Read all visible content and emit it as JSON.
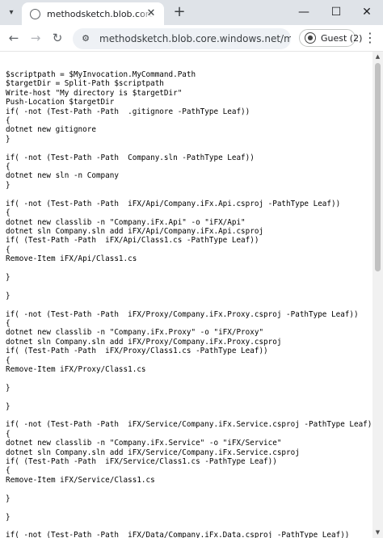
{
  "browser": {
    "tab": {
      "title": "methodsketch.blob.core.windows.net/methodsketch/...",
      "search_icon": "tab-search-icon",
      "close_glyph": "✕"
    },
    "new_tab_glyph": "+",
    "window_controls": {
      "minimize": "—",
      "maximize": "☐",
      "close": "✕"
    },
    "nav": {
      "back": "←",
      "forward": "→",
      "reload": "↻"
    },
    "omnibox": {
      "site_info_icon": "tune-icon",
      "url": "methodsketch.blob.core.windows.net/methodsketch/..."
    },
    "profile": {
      "label": "Guest (2)"
    },
    "menu_glyph": "⋮"
  },
  "document": {
    "lines": [
      "$scriptpath = $MyInvocation.MyCommand.Path",
      "$targetDir = Split-Path $scriptpath",
      "Write-host \"My directory is $targetDir\"",
      "Push-Location $targetDir",
      "if( -not (Test-Path -Path  .gitignore -PathType Leaf))",
      "{",
      "dotnet new gitignore",
      "}",
      "",
      "if( -not (Test-Path -Path  Company.sln -PathType Leaf))",
      "{",
      "dotnet new sln -n Company",
      "}",
      "",
      "if( -not (Test-Path -Path  iFX/Api/Company.iFx.Api.csproj -PathType Leaf))",
      "{",
      "dotnet new classlib -n \"Company.iFx.Api\" -o \"iFX/Api\"",
      "dotnet sln Company.sln add iFX/Api/Company.iFx.Api.csproj",
      "if( (Test-Path -Path  iFX/Api/Class1.cs -PathType Leaf))",
      "{",
      "Remove-Item iFX/Api/Class1.cs",
      "",
      "}",
      "",
      "}",
      "",
      "if( -not (Test-Path -Path  iFX/Proxy/Company.iFx.Proxy.csproj -PathType Leaf))",
      "{",
      "dotnet new classlib -n \"Company.iFx.Proxy\" -o \"iFX/Proxy\"",
      "dotnet sln Company.sln add iFX/Proxy/Company.iFx.Proxy.csproj",
      "if( (Test-Path -Path  iFX/Proxy/Class1.cs -PathType Leaf))",
      "{",
      "Remove-Item iFX/Proxy/Class1.cs",
      "",
      "}",
      "",
      "}",
      "",
      "if( -not (Test-Path -Path  iFX/Service/Company.iFx.Service.csproj -PathType Leaf))",
      "{",
      "dotnet new classlib -n \"Company.iFx.Service\" -o \"iFX/Service\"",
      "dotnet sln Company.sln add iFX/Service/Company.iFx.Service.csproj",
      "if( (Test-Path -Path  iFX/Service/Class1.cs -PathType Leaf))",
      "{",
      "Remove-Item iFX/Service/Class1.cs",
      "",
      "}",
      "",
      "}",
      "",
      "if( -not (Test-Path -Path  iFX/Data/Company.iFx.Data.csproj -PathType Leaf))",
      "{"
    ]
  },
  "scrollbar": {
    "up_glyph": "▲",
    "down_glyph": "▼"
  }
}
